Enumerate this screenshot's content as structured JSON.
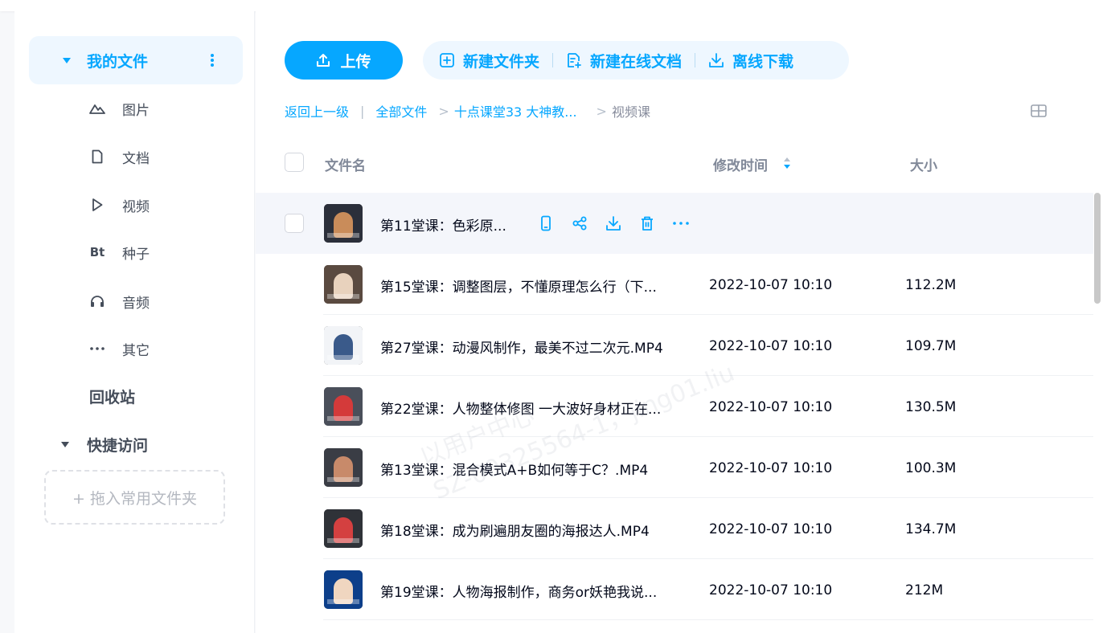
{
  "sidebar": {
    "my_files": "我的文件",
    "categories": [
      {
        "label": "图片",
        "icon": "image-icon"
      },
      {
        "label": "文档",
        "icon": "document-icon"
      },
      {
        "label": "视频",
        "icon": "video-play-icon"
      },
      {
        "label": "种子",
        "icon": "bt-icon"
      },
      {
        "label": "音频",
        "icon": "headphones-icon"
      },
      {
        "label": "其它",
        "icon": "more-dots-icon"
      }
    ],
    "bt_glyph": "Bt",
    "recycle_bin": "回收站",
    "quick_access": "快捷访问",
    "drop_zone": "+ 拖入常用文件夹"
  },
  "toolbar": {
    "upload": "上传",
    "new_folder": "新建文件夹",
    "new_online_doc": "新建在线文档",
    "offline_download": "离线下载"
  },
  "breadcrumb": {
    "back": "返回上一级",
    "all_files": "全部文件",
    "folder": "十点课堂33 大神教...",
    "current": "视频课"
  },
  "table": {
    "col_name": "文件名",
    "col_modified": "修改时间",
    "col_size": "大小"
  },
  "files": [
    {
      "name": "第11堂课：色彩原...",
      "date": "",
      "size": "",
      "thumb": [
        "#2b2f3a",
        "#c98c5a"
      ]
    },
    {
      "name": "第15堂课：调整图层，不懂原理怎么行（下...",
      "date": "2022-10-07 10:10",
      "size": "112.2M",
      "thumb": [
        "#5a4a40",
        "#e8d2bd"
      ]
    },
    {
      "name": "第27堂课：动漫风制作，最美不过二次元.MP4",
      "date": "2022-10-07 10:10",
      "size": "109.7M",
      "thumb": [
        "#f2f4f7",
        "#3a5a8a"
      ]
    },
    {
      "name": "第22堂课：人物整体修图 一大波好身材正在...",
      "date": "2022-10-07 10:10",
      "size": "130.5M",
      "thumb": [
        "#4a4f5a",
        "#d43a3a"
      ]
    },
    {
      "name": "第13堂课：混合模式A+B如何等于C？.MP4",
      "date": "2022-10-07 10:10",
      "size": "100.3M",
      "thumb": [
        "#3a3d45",
        "#c88a6a"
      ]
    },
    {
      "name": "第18堂课：成为刷遍朋友圈的海报达人.MP4",
      "date": "2022-10-07 10:10",
      "size": "134.7M",
      "thumb": [
        "#2f3238",
        "#d44040"
      ]
    },
    {
      "name": "第19堂课：人物海报制作，商务or妖艳我说...",
      "date": "2022-10-07 10:10",
      "size": "212M",
      "thumb": [
        "#0d3f8a",
        "#f0d6c0"
      ]
    }
  ],
  "watermark": [
    "以用户中心",
    "SZ-00325564-1，jing01.liu"
  ],
  "colors": {
    "accent": "#06a7ff",
    "accent_bg": "#eef7ff"
  }
}
